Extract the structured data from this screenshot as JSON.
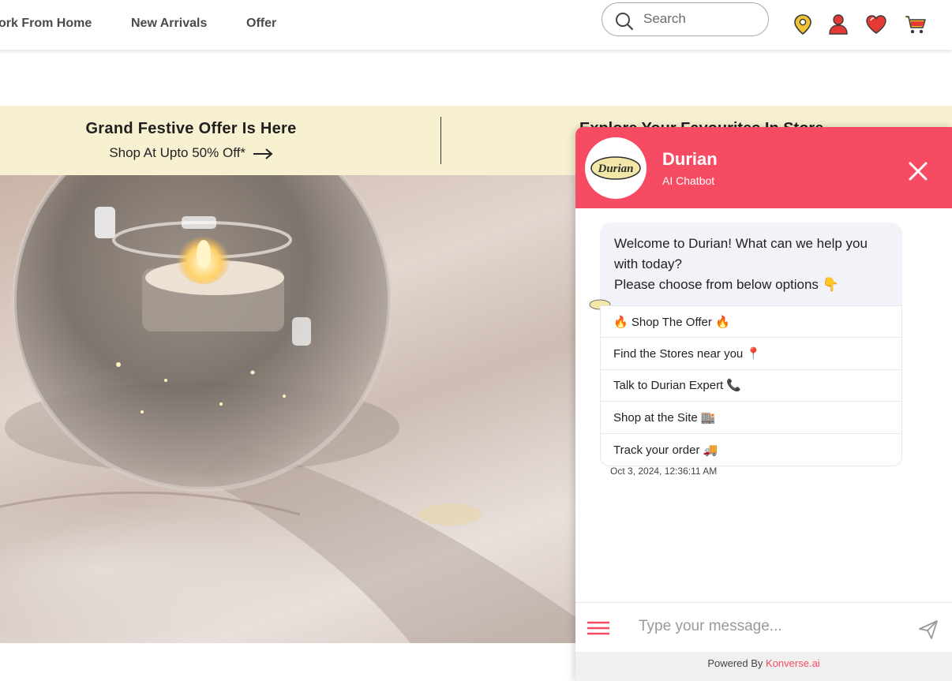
{
  "nav": {
    "links": [
      "ork From Home",
      "New Arrivals",
      "Offer"
    ],
    "search_placeholder": "Search"
  },
  "offer_strip": {
    "title": "Grand Festive Offer Is Here",
    "subtitle": "Shop At Upto 50% Off*",
    "right_text": "Explore Your Favourites In Store"
  },
  "chat": {
    "bot_name": "Durian",
    "bot_subtitle": "AI Chatbot",
    "logo_text": "Durian",
    "welcome_line1": "Welcome to Durian! What can we help you with today?",
    "welcome_line2": "Please choose from below options 👇",
    "options": [
      "🔥 Shop The Offer 🔥",
      "Find the Stores near you 📍",
      "Talk to Durian Expert 📞",
      "Shop at the Site 🏬",
      "Track your order 🚚"
    ],
    "timestamp": "Oct 3, 2024, 12:36:11 AM",
    "input_placeholder": "Type your message...",
    "powered_by": "Powered By",
    "powered_link": "Konverse.ai"
  },
  "colors": {
    "accent": "#f64b63",
    "offer_bg": "#f7f0d1",
    "bubble_bg": "#f3f2f8"
  },
  "icons": [
    "search-icon",
    "location-pin-icon",
    "user-icon",
    "heart-icon",
    "cart-icon",
    "arrow-right-icon",
    "close-icon",
    "menu-icon",
    "send-icon"
  ]
}
